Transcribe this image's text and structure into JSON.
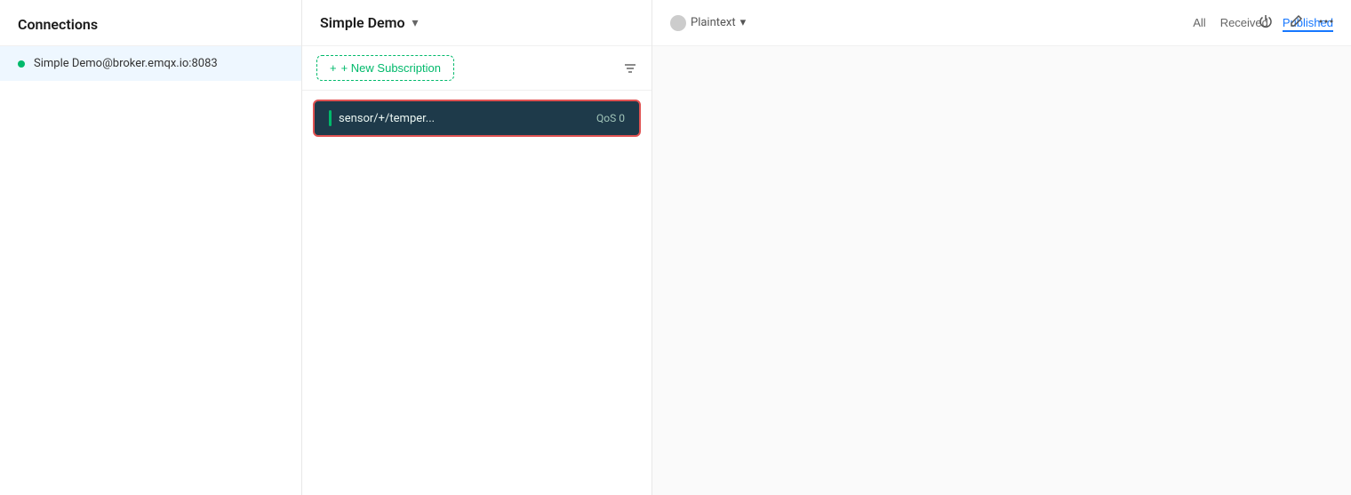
{
  "sidebar": {
    "title": "Connections",
    "items": [
      {
        "label": "Simple Demo@broker.emqx.io:8083",
        "status": "connected",
        "status_color": "#00b96b"
      }
    ]
  },
  "main": {
    "title": "Simple Demo",
    "chevron": "▾",
    "toolbar": {
      "new_subscription_label": "+ New Subscription",
      "filter_icon": "filter"
    },
    "subscriptions": [
      {
        "topic": "sensor/+/temper...",
        "qos": "QoS 0"
      }
    ]
  },
  "right_panel": {
    "format": {
      "label": "Plaintext",
      "icon": "circle"
    },
    "filter_tabs": [
      {
        "label": "All",
        "active": false
      },
      {
        "label": "Received",
        "active": false
      },
      {
        "label": "Published",
        "active": true
      }
    ]
  },
  "top_actions": {
    "power_icon": "⏻",
    "edit_icon": "✎",
    "more_icon": "⋯"
  }
}
